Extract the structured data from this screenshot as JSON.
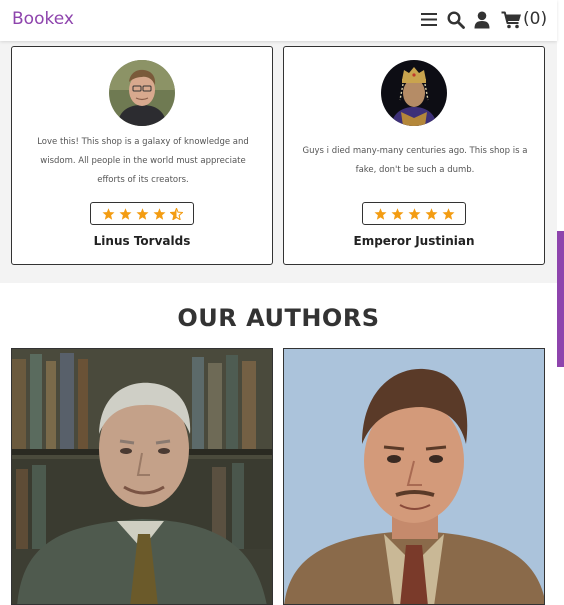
{
  "header": {
    "logo": "Bookex",
    "icons": [
      "menu-icon",
      "search-icon",
      "user-icon",
      "cart-icon"
    ],
    "cart_count": "(0)"
  },
  "reviews": [
    {
      "quote": "Love this! This shop is a galaxy of knowledge and wisdom. All people in the world must appreciate efforts of its creators.",
      "rating": 4.5,
      "name": "Linus Torvalds"
    },
    {
      "quote": "Guys i died many-many centuries ago. This shop is a fake, don't be such a dumb.",
      "rating": 5,
      "name": "Emperor Justinian"
    }
  ],
  "authors": {
    "title": "OUR AUTHORS"
  },
  "colors": {
    "brand": "#8e44ad",
    "star": "#f39c12"
  }
}
